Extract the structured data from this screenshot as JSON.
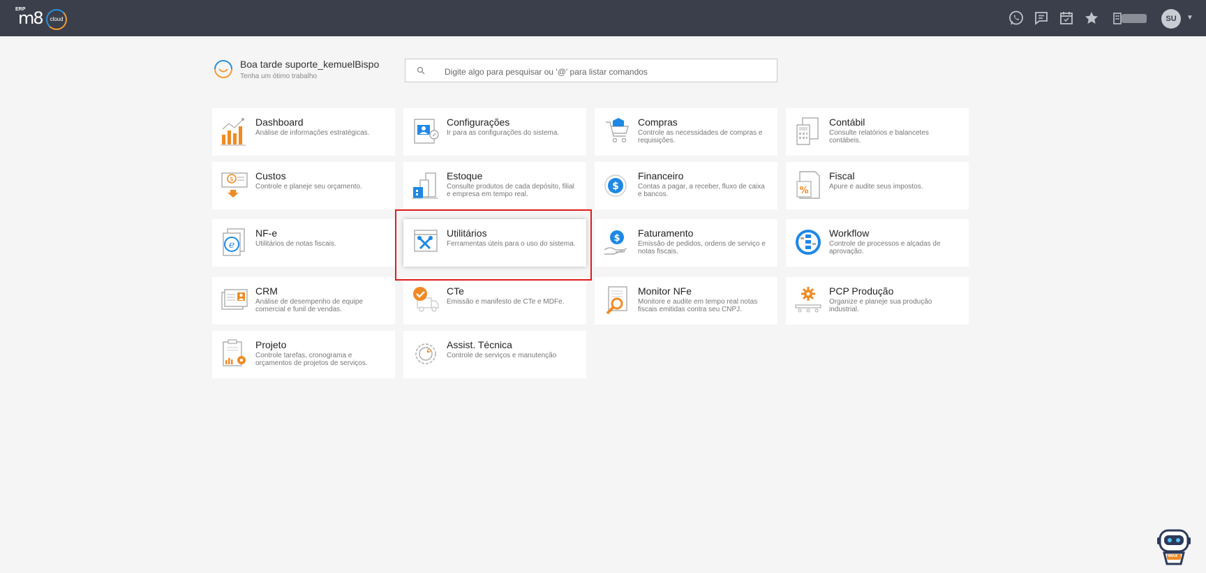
{
  "topbar": {
    "logo_erp": "ERP",
    "logo_m8": "m8",
    "logo_cloud": "cloud",
    "avatar_initials": "SU",
    "icons": [
      "whatsapp-icon",
      "chat-icon",
      "calendar-icon",
      "star-icon",
      "building-icon"
    ]
  },
  "greeting": {
    "title": "Boa tarde suporte_kemuelBispo",
    "subtitle": "Tenha um ótimo trabalho"
  },
  "search": {
    "placeholder": "Digite algo para pesquisar ou '@' para listar comandos"
  },
  "modules": [
    {
      "title": "Dashboard",
      "desc": "Análise de informações estratégicas."
    },
    {
      "title": "Configurações",
      "desc": "Ir para as configurações do sistema."
    },
    {
      "title": "Compras",
      "desc": "Controle as necessidades de compras e requisições."
    },
    {
      "title": "Contábil",
      "desc": "Consulte relatórios e balancetes contábeis."
    },
    {
      "title": "Custos",
      "desc": "Controle e planeje seu orçamento."
    },
    {
      "title": "Estoque",
      "desc": "Consulte produtos de cada depósito, filial e empresa em tempo real."
    },
    {
      "title": "Financeiro",
      "desc": "Contas a pagar, a receber, fluxo de caixa e bancos."
    },
    {
      "title": "Fiscal",
      "desc": "Apure e audite seus impostos."
    },
    {
      "title": "NF-e",
      "desc": "Utilitários de notas fiscais."
    },
    {
      "title": "Utilitários",
      "desc": "Ferramentas úteis para o uso do sistema."
    },
    {
      "title": "Faturamento",
      "desc": "Emissão de pedidos, ordens de serviço e notas fiscais."
    },
    {
      "title": "Workflow",
      "desc": "Controle de processos e alçadas de aprovação."
    },
    {
      "title": "CRM",
      "desc": "Análise de desempenho de equipe comercial e funil de vendas."
    },
    {
      "title": "CTe",
      "desc": "Emissão e manifesto de CTe e MDFe."
    },
    {
      "title": "Monitor NFe",
      "desc": "Monitore e audite em tempo real notas fiscais emitidas contra seu CNPJ."
    },
    {
      "title": "PCP Produção",
      "desc": "Organize e planeje sua produção industrial."
    },
    {
      "title": "Projeto",
      "desc": "Controle tarefas, cronograma e orçamentos de projetos de serviços."
    },
    {
      "title": "Assist. Técnica",
      "desc": "Controle de serviços e manutenção"
    }
  ],
  "assistant_label": "MAX",
  "colors": {
    "topbar": "#3a3f4b",
    "accent_orange": "#f08a24",
    "accent_blue": "#1e88e5",
    "highlight": "#e21b1b"
  }
}
